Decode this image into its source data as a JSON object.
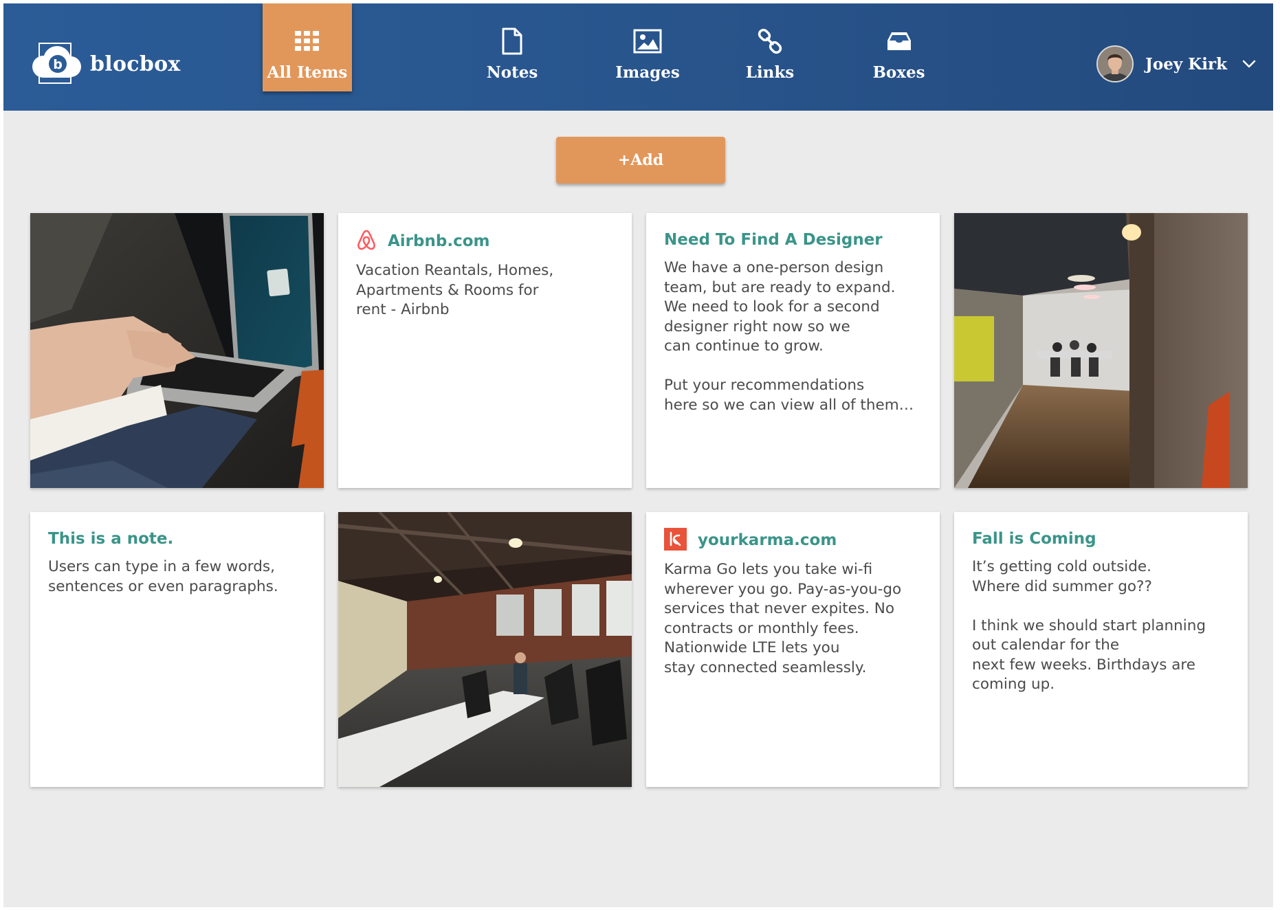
{
  "app": {
    "brand": "blocbox"
  },
  "nav": {
    "tabs": [
      {
        "label": "All Items",
        "icon": "grid-icon",
        "active": true
      },
      {
        "label": "Notes",
        "icon": "note-icon",
        "active": false
      },
      {
        "label": "Images",
        "icon": "image-icon",
        "active": false
      },
      {
        "label": "Links",
        "icon": "link-icon",
        "active": false
      },
      {
        "label": "Boxes",
        "icon": "inbox-icon",
        "active": false
      }
    ]
  },
  "user": {
    "name": "Joey Kirk"
  },
  "actions": {
    "add_label": "+Add"
  },
  "cards": [
    {
      "type": "image",
      "subject": "laptop-photo"
    },
    {
      "type": "link",
      "title": "Airbnb.com",
      "icon": "airbnb-icon",
      "body": "Vacation Reantals, Homes,\nApartments & Rooms for\nrent - Airbnb"
    },
    {
      "type": "note",
      "title": "Need To Find A Designer",
      "body": "We have a one-person design\nteam, but are ready to expand.\nWe need to look for a second\ndesigner right now so we\ncan continue to grow.\n\nPut your recommendations\nhere so we can view all of them…"
    },
    {
      "type": "image",
      "subject": "office-hallway-photo"
    },
    {
      "type": "note",
      "title": "This is a note.",
      "body": "Users can type in a few words,\nsentences or even paragraphs."
    },
    {
      "type": "image",
      "subject": "open-office-photo"
    },
    {
      "type": "link",
      "title": "yourkarma.com",
      "icon": "karma-icon",
      "body": "Karma Go lets you take wi-fi\nwherever you go. Pay-as-you-go\nservices that never expites. No\ncontracts or monthly fees.\nNationwide LTE lets you\nstay connected seamlessly."
    },
    {
      "type": "note",
      "title": "Fall is Coming",
      "body": "It’s getting cold outside.\nWhere did summer go??\n\nI think we should start planning\nout calendar for the\nnext few weeks. Birthdays are\ncoming up."
    }
  ],
  "colors": {
    "header": "#2b5c97",
    "accent": "#e2975a",
    "title_teal": "#3a9489",
    "background": "#ebebeb",
    "airbnb": "#ff5a5f",
    "karma": "#e8533a"
  }
}
